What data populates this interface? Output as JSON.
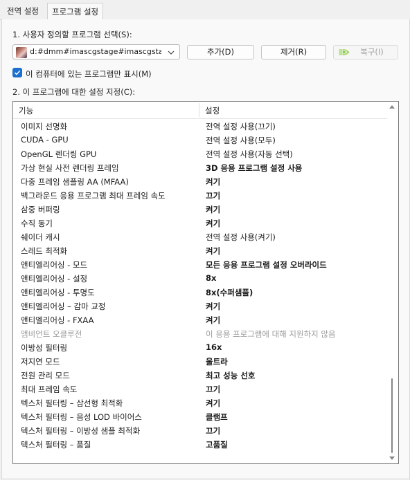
{
  "tabs": [
    {
      "label": "전역 설정",
      "active": false
    },
    {
      "label": "프로그램 설정",
      "active": true
    }
  ],
  "step1": {
    "label": "1. 사용자 정의할 프로그램 선택(S):",
    "selected_program": "d:#dmm#imascgstage#imascgsta...",
    "add_button": "추가(D)",
    "remove_button": "제거(R)",
    "restore_button": "복구(I)",
    "restore_disabled": true
  },
  "filter": {
    "checked": true,
    "label": "이 컴퓨터에 있는 프로그램만 표시(M)"
  },
  "step2": {
    "label": "2. 이 프로그램에 대한 설정 지정(C):",
    "columns": {
      "feature": "기능",
      "setting": "설정"
    },
    "rows": [
      {
        "feature": "이미지 선명화",
        "setting": "전역 설정 사용(끄기)",
        "bold": false,
        "disabled": false
      },
      {
        "feature": "CUDA - GPU",
        "setting": "전역 설정 사용(모두)",
        "bold": false,
        "disabled": false
      },
      {
        "feature": "OpenGL 렌더링 GPU",
        "setting": "전역 설정 사용(자동 선택)",
        "bold": false,
        "disabled": false
      },
      {
        "feature": "가상 현실 사전 렌더링 프레임",
        "setting": "3D 응용 프로그램 설정 사용",
        "bold": true,
        "disabled": false
      },
      {
        "feature": "다중 프레임 샘플링 AA (MFAA)",
        "setting": "켜기",
        "bold": true,
        "disabled": false
      },
      {
        "feature": "백그라운드 응용 프로그램 최대 프레임 속도",
        "setting": "끄기",
        "bold": true,
        "disabled": false
      },
      {
        "feature": "삼중 버퍼링",
        "setting": "켜기",
        "bold": true,
        "disabled": false
      },
      {
        "feature": "수직 동기",
        "setting": "켜기",
        "bold": true,
        "disabled": false
      },
      {
        "feature": "쉐이더 캐시",
        "setting": "전역 설정 사용(켜기)",
        "bold": false,
        "disabled": false
      },
      {
        "feature": "스레드 최적화",
        "setting": "켜기",
        "bold": true,
        "disabled": false
      },
      {
        "feature": "앤티엘리어싱 - 모드",
        "setting": "모든 응용 프로그램 설정 오버라이드",
        "bold": true,
        "disabled": false
      },
      {
        "feature": "앤티엘리어싱 - 설정",
        "setting": "8x",
        "bold": true,
        "disabled": false
      },
      {
        "feature": "앤티엘리어싱 - 투명도",
        "setting": "8x(수퍼샘플)",
        "bold": true,
        "disabled": false
      },
      {
        "feature": "앤티엘리어싱 – 감마 교정",
        "setting": "켜기",
        "bold": true,
        "disabled": false
      },
      {
        "feature": "앤티엘리어싱 - FXAA",
        "setting": "켜기",
        "bold": true,
        "disabled": false
      },
      {
        "feature": "앰비언트 오클루전",
        "setting": "이 응용 프로그램에 대해 지원하지 않음",
        "bold": false,
        "disabled": true
      },
      {
        "feature": "이방성 필터링",
        "setting": "16x",
        "bold": true,
        "disabled": false
      },
      {
        "feature": "저지연 모드",
        "setting": "울트라",
        "bold": true,
        "disabled": false
      },
      {
        "feature": "전원 관리 모드",
        "setting": "최고 성능 선호",
        "bold": true,
        "disabled": false
      },
      {
        "feature": "최대 프레임 속도",
        "setting": "끄기",
        "bold": true,
        "disabled": false
      },
      {
        "feature": "텍스처 필터링 – 삼선형 최적화",
        "setting": "켜기",
        "bold": true,
        "disabled": false
      },
      {
        "feature": "텍스처 필터링 – 음성 LOD 바이어스",
        "setting": "클램프",
        "bold": true,
        "disabled": false
      },
      {
        "feature": "텍스처 필터링 – 이방성 샘플 최적화",
        "setting": "끄기",
        "bold": true,
        "disabled": false
      },
      {
        "feature": "텍스처 필터링 – 품질",
        "setting": "고품질",
        "bold": true,
        "disabled": false
      }
    ]
  },
  "colors": {
    "accent": "#1c6fce",
    "nvidia_green": "#8ccf4a",
    "disabled_text": "#9a9a9a"
  }
}
